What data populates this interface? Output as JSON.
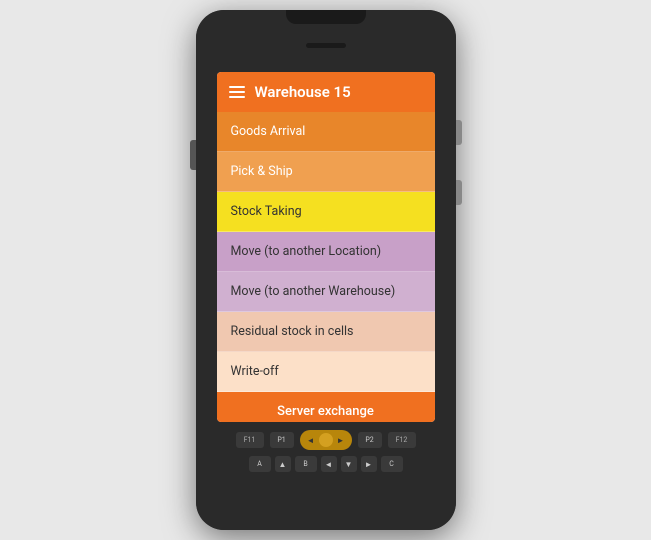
{
  "device": {
    "title": "Warehouse 15"
  },
  "header": {
    "title": "Warehouse 15",
    "menu_icon": "hamburger"
  },
  "menu": {
    "items": [
      {
        "id": "goods-arrival",
        "label": "Goods Arrival",
        "color_class": "menu-item-goods-arrival"
      },
      {
        "id": "pick-ship",
        "label": "Pick & Ship",
        "color_class": "menu-item-pick-ship"
      },
      {
        "id": "stock-taking",
        "label": "Stock Taking",
        "color_class": "menu-item-stock-taking"
      },
      {
        "id": "move-location",
        "label": "Move (to another Location)",
        "color_class": "menu-item-move-location"
      },
      {
        "id": "move-warehouse",
        "label": "Move (to another Warehouse)",
        "color_class": "menu-item-move-warehouse"
      },
      {
        "id": "residual-stock",
        "label": "Residual stock in cells",
        "color_class": "menu-item-residual"
      },
      {
        "id": "write-off",
        "label": "Write-off",
        "color_class": "menu-item-writeoff"
      }
    ],
    "server_exchange_label": "Server exchange"
  },
  "keypad": {
    "fn_keys": [
      "F11",
      "F12"
    ],
    "p_keys": [
      "P1",
      "P2"
    ],
    "nav_arrows": [
      "◄",
      "►",
      "▲",
      "▼"
    ],
    "letter_keys": [
      "A",
      "B",
      "C"
    ],
    "arrow_keys": [
      "▲",
      "◄",
      "▼",
      "►"
    ]
  }
}
